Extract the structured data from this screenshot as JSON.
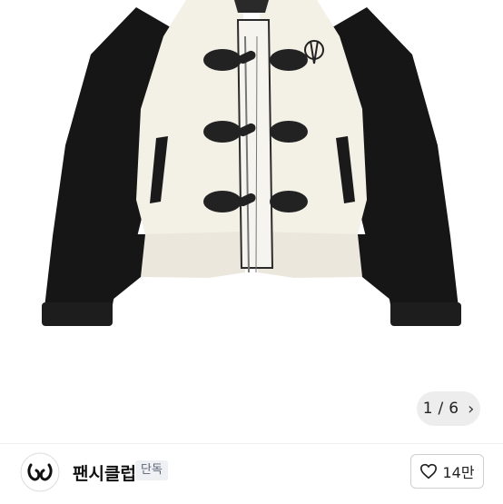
{
  "pager": {
    "current": "1",
    "separator": "/",
    "total": "6",
    "next_icon": "chevron-right-icon"
  },
  "store": {
    "name": "팬시클럽",
    "badge": "단독",
    "logo_icon": "fancyclub-logo-icon"
  },
  "like": {
    "icon": "heart-outline-icon",
    "count": "14만"
  },
  "colors": {
    "jacket_body": "#f3f0e6",
    "jacket_sleeve": "#161616",
    "badge_bg": "#eef0f4",
    "badge_text": "#5a6377"
  }
}
